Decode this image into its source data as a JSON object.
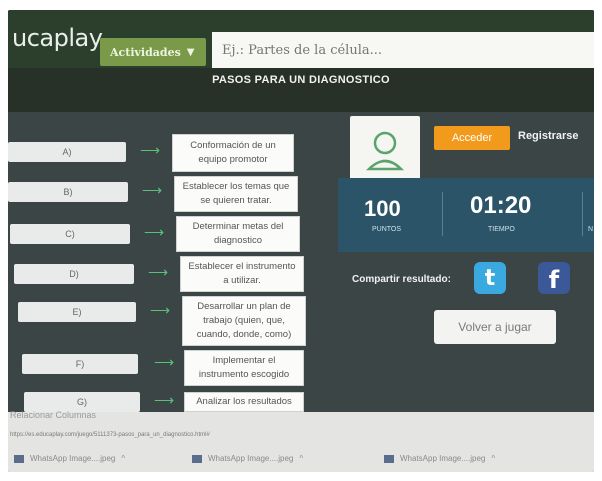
{
  "header": {
    "logo_text": "ucaplay",
    "activities_label": "Actividades",
    "search_placeholder": "Ej.: Partes de la célula..."
  },
  "game": {
    "title": "PASOS PARA UN DIAGNOSTICO",
    "rows": [
      {
        "letter": "A)",
        "text": "Conformación de un equipo promotor"
      },
      {
        "letter": "B)",
        "text": "Establecer los temas que se quieren tratar."
      },
      {
        "letter": "C)",
        "text": "Determinar metas del diagnostico"
      },
      {
        "letter": "D)",
        "text": "Establecer el instrumento a utilizar."
      },
      {
        "letter": "E)",
        "text": "Desarrollar un plan de trabajo (quien, que, cuando, donde, como)"
      },
      {
        "letter": "F)",
        "text": "Implementar el instrumento escogido"
      },
      {
        "letter": "G)",
        "text": "Analizar los resultados"
      }
    ]
  },
  "panel": {
    "login_label": "Acceder",
    "register_label": "Registrarse",
    "points_value": "100",
    "points_label": "PUNTOS",
    "time_value": "01:20",
    "time_label": "TIEMPO",
    "third_label": "N",
    "share_label": "Compartir resultado:",
    "replay_label": "Volver a jugar"
  },
  "browser": {
    "below_text": "Relacionar Columnas",
    "url": "https://es.educaplay.com/juego/5111373-pasos_para_un_diagnostico.html#",
    "downloads": [
      "WhatsApp Image....jpeg",
      "WhatsApp Image....jpeg",
      "WhatsApp Image....jpeg"
    ]
  },
  "colors": {
    "accent_orange": "#f29a1c",
    "activities_green": "#7a9a4a",
    "arrow_green": "#59c27a",
    "stats_blue": "#2b5468"
  }
}
